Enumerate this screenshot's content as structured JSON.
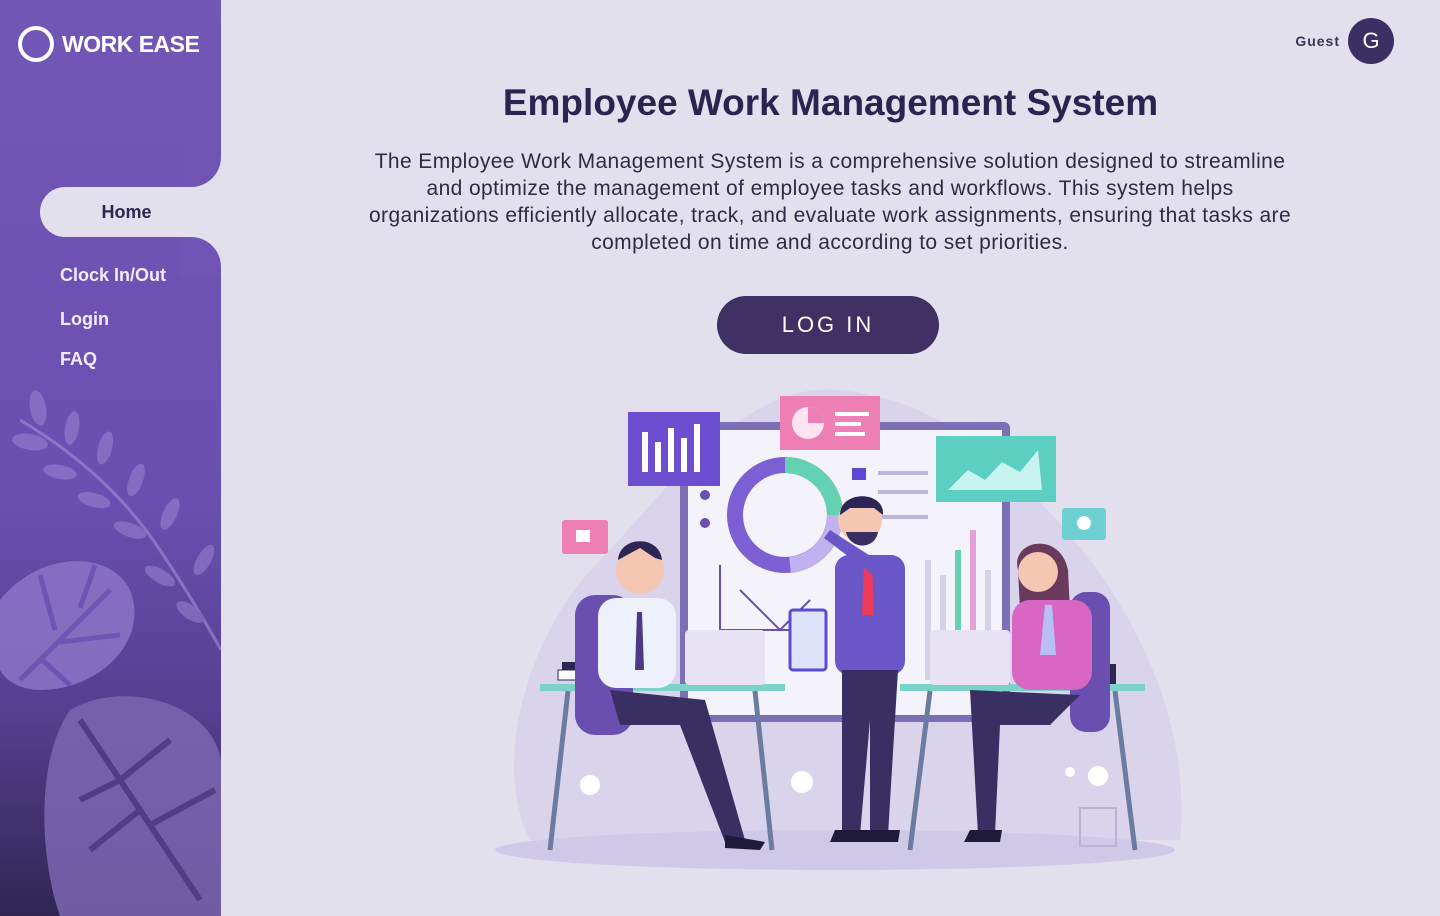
{
  "brand": {
    "name": "WORK EASE"
  },
  "nav": {
    "items": [
      {
        "label": "Home",
        "active": true
      },
      {
        "label": "Clock In/Out"
      },
      {
        "label": "Login"
      },
      {
        "label": "FAQ"
      }
    ]
  },
  "user": {
    "label": "Guest",
    "initial": "G"
  },
  "main": {
    "title": "Employee Work Management System",
    "description": "The Employee Work Management System is a comprehensive solution designed to streamline and optimize the management of employee tasks and workflows. This system helps organizations efficiently allocate, track, and evaluate work assignments, ensuring that tasks are completed on time and according to set priorities.",
    "login_label": "LOG IN"
  },
  "colors": {
    "sidebar": "#6a4fb0",
    "background": "#e3e0ee",
    "accent_dark": "#3f3163"
  }
}
